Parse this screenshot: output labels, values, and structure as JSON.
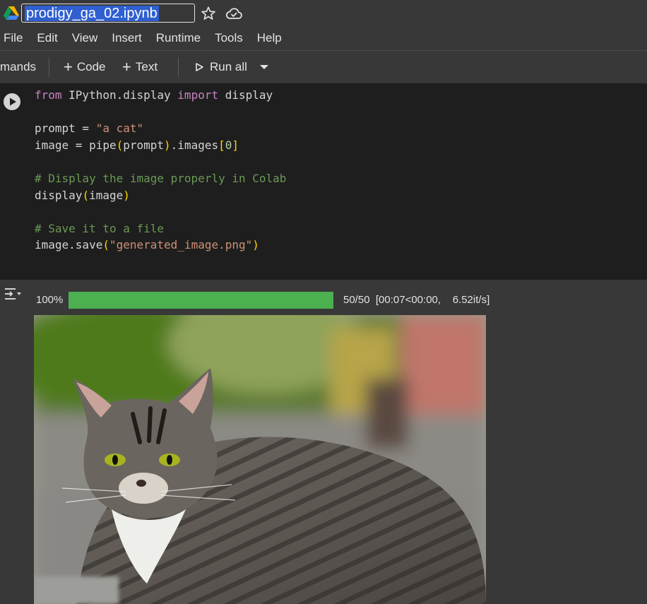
{
  "notebook": {
    "filename": "prodigy_ga_02.ipynb"
  },
  "menu": [
    "File",
    "Edit",
    "View",
    "Insert",
    "Runtime",
    "Tools",
    "Help"
  ],
  "toolbar": {
    "commands_label": "mands",
    "code_label": "Code",
    "text_label": "Text",
    "run_all_label": "Run all"
  },
  "code_lines": [
    [
      {
        "t": "from",
        "c": "kw"
      },
      {
        "t": " IPython.display "
      },
      {
        "t": "import",
        "c": "kw"
      },
      {
        "t": " display"
      }
    ],
    [],
    [
      {
        "t": "prompt = "
      },
      {
        "t": "\"a cat\"",
        "c": "str"
      }
    ],
    [
      {
        "t": "image = pipe"
      },
      {
        "t": "(",
        "c": "par"
      },
      {
        "t": "prompt"
      },
      {
        "t": ")",
        "c": "par"
      },
      {
        "t": ".images"
      },
      {
        "t": "[",
        "c": "par"
      },
      {
        "t": "0",
        "c": "num"
      },
      {
        "t": "]",
        "c": "par"
      }
    ],
    [],
    [
      {
        "t": "# Display the image properly in Colab",
        "c": "cm"
      }
    ],
    [
      {
        "t": "display"
      },
      {
        "t": "(",
        "c": "par"
      },
      {
        "t": "image"
      },
      {
        "t": ")",
        "c": "par"
      }
    ],
    [],
    [
      {
        "t": "# Save it to a file",
        "c": "cm"
      }
    ],
    [
      {
        "t": "image.save"
      },
      {
        "t": "(",
        "c": "par"
      },
      {
        "t": "\"generated_image.png\"",
        "c": "str"
      },
      {
        "t": ")",
        "c": "par"
      }
    ]
  ],
  "output": {
    "percent_label": "100%",
    "progress": 1.0,
    "status_text": "50/50  [00:07<00:00,    6.52it/s]"
  },
  "colors": {
    "progress": "#4caf50",
    "selection": "#2f5fd0",
    "background": "#383838",
    "cell_bg": "#1e1e1e"
  },
  "icons": [
    "drive-icon",
    "star-icon",
    "cloud-icon",
    "plus-icon",
    "play-icon",
    "caret-down-icon",
    "run-cell-icon",
    "output-toggle-icon"
  ]
}
